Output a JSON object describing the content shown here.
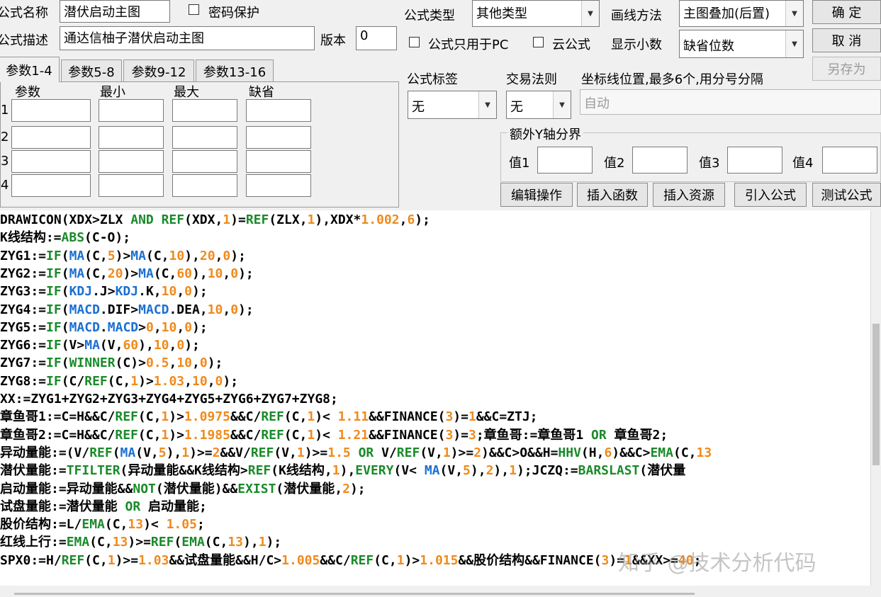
{
  "form": {
    "name_label": "公式名称",
    "name_value": "潜伏启动主图",
    "password_label": "密码保护",
    "desc_label": "公式描述",
    "desc_value": "通达信柚子潜伏启动主图",
    "version_label": "版本",
    "version_value": "0",
    "type_label": "公式类型",
    "type_value": "其他类型",
    "draw_label": "画线方法",
    "draw_value": "主图叠加(后置)",
    "pc_only_label": "公式只用于PC",
    "cloud_label": "云公式",
    "decimals_label": "显示小数",
    "decimals_value": "缺省位数",
    "tag_label": "公式标签",
    "tag_value": "无",
    "trade_label": "交易法则",
    "trade_value": "无",
    "axis_label": "坐标线位置,最多6个,用分号分隔",
    "axis_placeholder": "自动",
    "yaxis_group_label": "额外Y轴分界",
    "yaxis_values": [
      "值1",
      "值2",
      "值3",
      "值4"
    ]
  },
  "buttons": {
    "ok": "确 定",
    "cancel": "取 消",
    "save_as": "另存为",
    "edit_ops": "编辑操作",
    "insert_func": "插入函数",
    "insert_res": "插入资源",
    "import_formula": "引入公式",
    "test_formula": "测试公式"
  },
  "tabs": [
    "参数1-4",
    "参数5-8",
    "参数9-12",
    "参数13-16"
  ],
  "param_table": {
    "headers": [
      "参数",
      "最小",
      "最大",
      "缺省"
    ],
    "rows": [
      "1",
      "2",
      "3",
      "4"
    ]
  },
  "code": [
    [
      [
        "",
        "DRAWICON(XDX>ZLX "
      ],
      [
        "g",
        "AND"
      ],
      [
        "",
        " "
      ],
      [
        "g",
        "REF"
      ],
      [
        "",
        "(XDX,"
      ],
      [
        "o",
        "1"
      ],
      [
        "",
        ")="
      ],
      [
        "g",
        "REF"
      ],
      [
        "",
        "(ZLX,"
      ],
      [
        "o",
        "1"
      ],
      [
        "",
        "),XDX*"
      ],
      [
        "o",
        "1.002"
      ],
      [
        "",
        ","
      ],
      [
        "o",
        "6"
      ],
      [
        "",
        ");"
      ]
    ],
    [
      [
        "",
        "K线结构:="
      ],
      [
        "g",
        "ABS"
      ],
      [
        "",
        "(C-O);"
      ]
    ],
    [
      [
        "",
        "ZYG1:="
      ],
      [
        "g",
        "IF"
      ],
      [
        "",
        "("
      ],
      [
        "b",
        "MA"
      ],
      [
        "",
        "(C,"
      ],
      [
        "o",
        "5"
      ],
      [
        "",
        ")>"
      ],
      [
        "b",
        "MA"
      ],
      [
        "",
        "(C,"
      ],
      [
        "o",
        "10"
      ],
      [
        "",
        "),"
      ],
      [
        "o",
        "20"
      ],
      [
        "",
        ","
      ],
      [
        "o",
        "0"
      ],
      [
        "",
        ");"
      ]
    ],
    [
      [
        "",
        "ZYG2:="
      ],
      [
        "g",
        "IF"
      ],
      [
        "",
        "("
      ],
      [
        "b",
        "MA"
      ],
      [
        "",
        "(C,"
      ],
      [
        "o",
        "20"
      ],
      [
        "",
        ")>"
      ],
      [
        "b",
        "MA"
      ],
      [
        "",
        "(C,"
      ],
      [
        "o",
        "60"
      ],
      [
        "",
        "),"
      ],
      [
        "o",
        "10"
      ],
      [
        "",
        ","
      ],
      [
        "o",
        "0"
      ],
      [
        "",
        ");"
      ]
    ],
    [
      [
        "",
        "ZYG3:="
      ],
      [
        "g",
        "IF"
      ],
      [
        "",
        "("
      ],
      [
        "b",
        "KDJ"
      ],
      [
        "",
        ".J>"
      ],
      [
        "b",
        "KDJ"
      ],
      [
        "",
        ".K,"
      ],
      [
        "o",
        "10"
      ],
      [
        "",
        ","
      ],
      [
        "o",
        "0"
      ],
      [
        "",
        ");"
      ]
    ],
    [
      [
        "",
        "ZYG4:="
      ],
      [
        "g",
        "IF"
      ],
      [
        "",
        "("
      ],
      [
        "b",
        "MACD"
      ],
      [
        "",
        ".DIF>"
      ],
      [
        "b",
        "MACD"
      ],
      [
        "",
        ".DEA,"
      ],
      [
        "o",
        "10"
      ],
      [
        "",
        ","
      ],
      [
        "o",
        "0"
      ],
      [
        "",
        ");"
      ]
    ],
    [
      [
        "",
        "ZYG5:="
      ],
      [
        "g",
        "IF"
      ],
      [
        "",
        "("
      ],
      [
        "b",
        "MACD"
      ],
      [
        "",
        "."
      ],
      [
        "b",
        "MACD"
      ],
      [
        "",
        ">"
      ],
      [
        "o",
        "0"
      ],
      [
        "",
        ","
      ],
      [
        "o",
        "10"
      ],
      [
        "",
        ","
      ],
      [
        "o",
        "0"
      ],
      [
        "",
        ");"
      ]
    ],
    [
      [
        "",
        "ZYG6:="
      ],
      [
        "g",
        "IF"
      ],
      [
        "",
        "(V>"
      ],
      [
        "b",
        "MA"
      ],
      [
        "",
        "(V,"
      ],
      [
        "o",
        "60"
      ],
      [
        "",
        "),"
      ],
      [
        "o",
        "10"
      ],
      [
        "",
        ","
      ],
      [
        "o",
        "0"
      ],
      [
        "",
        ");"
      ]
    ],
    [
      [
        "",
        "ZYG7:="
      ],
      [
        "g",
        "IF"
      ],
      [
        "",
        "("
      ],
      [
        "g",
        "WINNER"
      ],
      [
        "",
        "(C)>"
      ],
      [
        "o",
        "0.5"
      ],
      [
        "",
        ","
      ],
      [
        "o",
        "10"
      ],
      [
        "",
        ","
      ],
      [
        "o",
        "0"
      ],
      [
        "",
        ");"
      ]
    ],
    [
      [
        "",
        "ZYG8:="
      ],
      [
        "g",
        "IF"
      ],
      [
        "",
        "(C/"
      ],
      [
        "g",
        "REF"
      ],
      [
        "",
        "(C,"
      ],
      [
        "o",
        "1"
      ],
      [
        "",
        ")>"
      ],
      [
        "o",
        "1.03"
      ],
      [
        "",
        ","
      ],
      [
        "o",
        "10"
      ],
      [
        "",
        ","
      ],
      [
        "o",
        "0"
      ],
      [
        "",
        ");"
      ]
    ],
    [
      [
        "",
        "XX:=ZYG1+ZYG2+ZYG3+ZYG4+ZYG5+ZYG6+ZYG7+ZYG8;"
      ]
    ],
    [
      [
        "",
        "章鱼哥1:=C=H&&C/"
      ],
      [
        "g",
        "REF"
      ],
      [
        "",
        "(C,"
      ],
      [
        "o",
        "1"
      ],
      [
        "",
        ")>"
      ],
      [
        "o",
        "1.0975"
      ],
      [
        "",
        "&&C/"
      ],
      [
        "g",
        "REF"
      ],
      [
        "",
        "(C,"
      ],
      [
        "o",
        "1"
      ],
      [
        "",
        ")< "
      ],
      [
        "o",
        "1.11"
      ],
      [
        "",
        "&&FINANCE("
      ],
      [
        "o",
        "3"
      ],
      [
        "",
        ")="
      ],
      [
        "o",
        "1"
      ],
      [
        "",
        "&&C=ZTJ;"
      ]
    ],
    [
      [
        "",
        "章鱼哥2:=C=H&&C/"
      ],
      [
        "g",
        "REF"
      ],
      [
        "",
        "(C,"
      ],
      [
        "o",
        "1"
      ],
      [
        "",
        ")>"
      ],
      [
        "o",
        "1.1985"
      ],
      [
        "",
        "&&C/"
      ],
      [
        "g",
        "REF"
      ],
      [
        "",
        "(C,"
      ],
      [
        "o",
        "1"
      ],
      [
        "",
        ")< "
      ],
      [
        "o",
        "1.21"
      ],
      [
        "",
        "&&FINANCE("
      ],
      [
        "o",
        "3"
      ],
      [
        "",
        ")="
      ],
      [
        "o",
        "3"
      ],
      [
        "",
        ";章鱼哥:=章鱼哥1 "
      ],
      [
        "g",
        "OR"
      ],
      [
        "",
        " 章鱼哥2;"
      ]
    ],
    [
      [
        "",
        "异动量能:=(V/"
      ],
      [
        "g",
        "REF"
      ],
      [
        "",
        "("
      ],
      [
        "b",
        "MA"
      ],
      [
        "",
        "(V,"
      ],
      [
        "o",
        "5"
      ],
      [
        "",
        "),"
      ],
      [
        "o",
        "1"
      ],
      [
        "",
        ")>="
      ],
      [
        "o",
        "2"
      ],
      [
        "",
        "&&V/"
      ],
      [
        "g",
        "REF"
      ],
      [
        "",
        "(V,"
      ],
      [
        "o",
        "1"
      ],
      [
        "",
        ")>="
      ],
      [
        "o",
        "1.5"
      ],
      [
        "",
        " "
      ],
      [
        "g",
        "OR"
      ],
      [
        "",
        " V/"
      ],
      [
        "g",
        "REF"
      ],
      [
        "",
        "(V,"
      ],
      [
        "o",
        "1"
      ],
      [
        "",
        ")>="
      ],
      [
        "o",
        "2"
      ],
      [
        "",
        ")&&C>O&&H="
      ],
      [
        "g",
        "HHV"
      ],
      [
        "",
        "(H,"
      ],
      [
        "o",
        "6"
      ],
      [
        "",
        ")&&C>"
      ],
      [
        "g",
        "EMA"
      ],
      [
        "",
        "(C,"
      ],
      [
        "o",
        "13"
      ]
    ],
    [
      [
        "",
        "潜伏量能:="
      ],
      [
        "g",
        "TFILTER"
      ],
      [
        "",
        "(异动量能&&K线结构>"
      ],
      [
        "g",
        "REF"
      ],
      [
        "",
        "(K线结构,"
      ],
      [
        "o",
        "1"
      ],
      [
        "",
        "),"
      ],
      [
        "g",
        "EVERY"
      ],
      [
        "",
        "(V< "
      ],
      [
        "b",
        "MA"
      ],
      [
        "",
        "(V,"
      ],
      [
        "o",
        "5"
      ],
      [
        "",
        "),"
      ],
      [
        "o",
        "2"
      ],
      [
        "",
        "),"
      ],
      [
        "o",
        "1"
      ],
      [
        "",
        ");JCZQ:="
      ],
      [
        "g",
        "BARSLAST"
      ],
      [
        "",
        "(潜伏量"
      ]
    ],
    [
      [
        "",
        "启动量能:=异动量能&&"
      ],
      [
        "g",
        "NOT"
      ],
      [
        "",
        "(潜伏量能)&&"
      ],
      [
        "g",
        "EXIST"
      ],
      [
        "",
        "(潜伏量能,"
      ],
      [
        "o",
        "2"
      ],
      [
        "",
        ");"
      ]
    ],
    [
      [
        "",
        "试盘量能:=潜伏量能 "
      ],
      [
        "g",
        "OR"
      ],
      [
        "",
        " 启动量能;"
      ]
    ],
    [
      [
        "",
        "股价结构:=L/"
      ],
      [
        "g",
        "EMA"
      ],
      [
        "",
        "(C,"
      ],
      [
        "o",
        "13"
      ],
      [
        "",
        ")< "
      ],
      [
        "o",
        "1.05"
      ],
      [
        "",
        ";"
      ]
    ],
    [
      [
        "",
        "红线上行:="
      ],
      [
        "g",
        "EMA"
      ],
      [
        "",
        "(C,"
      ],
      [
        "o",
        "13"
      ],
      [
        "",
        ")>="
      ],
      [
        "g",
        "REF"
      ],
      [
        "",
        "("
      ],
      [
        "g",
        "EMA"
      ],
      [
        "",
        "(C,"
      ],
      [
        "o",
        "13"
      ],
      [
        "",
        "),"
      ],
      [
        "o",
        "1"
      ],
      [
        "",
        ");"
      ]
    ],
    [
      [
        "",
        "SPX0:=H/"
      ],
      [
        "g",
        "REF"
      ],
      [
        "",
        "(C,"
      ],
      [
        "o",
        "1"
      ],
      [
        "",
        ")>="
      ],
      [
        "o",
        "1.03"
      ],
      [
        "",
        "&&试盘量能&&H/C>"
      ],
      [
        "o",
        "1.005"
      ],
      [
        "",
        "&&C/"
      ],
      [
        "g",
        "REF"
      ],
      [
        "",
        "(C,"
      ],
      [
        "o",
        "1"
      ],
      [
        "",
        ")>"
      ],
      [
        "o",
        "1.015"
      ],
      [
        "",
        "&&股价结构&&FINANCE("
      ],
      [
        "o",
        "3"
      ],
      [
        "",
        ")="
      ],
      [
        "o",
        "1"
      ],
      [
        "",
        "&&XX>="
      ],
      [
        "o",
        "40"
      ],
      [
        "",
        ";"
      ]
    ]
  ],
  "watermark": "知乎 @技术分析代码"
}
